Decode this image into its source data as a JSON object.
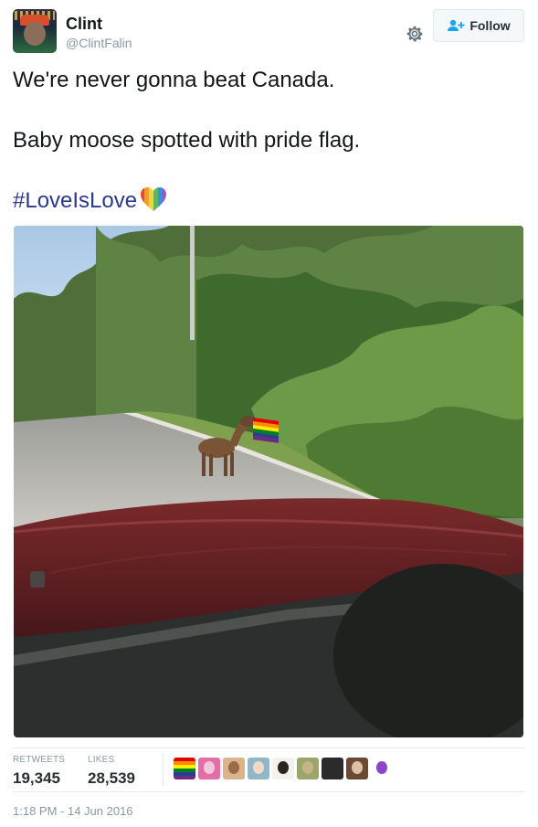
{
  "user": {
    "display_name": "Clint",
    "handle": "@ClintFalin",
    "avatar_icon": "profile-avatar"
  },
  "actions": {
    "settings_icon": "gear-icon",
    "follow_label": "Follow",
    "follow_icon": "add-user-icon"
  },
  "tweet": {
    "line1": "We're never gonna beat Canada.",
    "line2": "Baby moose spotted with pride flag.",
    "hashtag": "#LoveIsLove",
    "emoji": "rainbow-heart-icon"
  },
  "media": {
    "kind": "photo",
    "subject": "baby-moose-with-pride-flag"
  },
  "stats": {
    "retweets_label": "RETWEETS",
    "retweets_value": "19,345",
    "likes_label": "LIKES",
    "likes_value": "28,539"
  },
  "likers": [
    {
      "name": "liker-avatar-rainbow-flag",
      "colors": [
        "#e40303",
        "#ff8c00",
        "#ffed00",
        "#008026",
        "#24408e",
        "#732982"
      ]
    },
    {
      "name": "liker-avatar-pink",
      "bg": "#e06fa8",
      "face": "#f4c6dd"
    },
    {
      "name": "liker-avatar-group",
      "bg": "#d9b38c",
      "face": "#9a6b46"
    },
    {
      "name": "liker-avatar-blue",
      "bg": "#8fb6c9",
      "face": "#f0d9c7"
    },
    {
      "name": "liker-avatar-woman",
      "bg": "#f4f0ec",
      "face": "#2a2422"
    },
    {
      "name": "liker-avatar-outdoor",
      "bg": "#9aa66a",
      "face": "#c9b28a"
    },
    {
      "name": "liker-avatar-dark",
      "bg": "#2b2b2b",
      "face": "#2b2b2b"
    },
    {
      "name": "liker-avatar-brunette",
      "bg": "#6b4a35",
      "face": "#e1bfa5"
    },
    {
      "name": "liker-avatar-purple",
      "bg": "#ffffff",
      "face": "#8a45c9"
    }
  ],
  "timestamp": "1:18 PM - 14 Jun 2016",
  "colors": {
    "hashtag": "#2b3a8c",
    "follow_icon": "#1da1f2",
    "muted": "#8899a6",
    "text": "#14171a"
  }
}
